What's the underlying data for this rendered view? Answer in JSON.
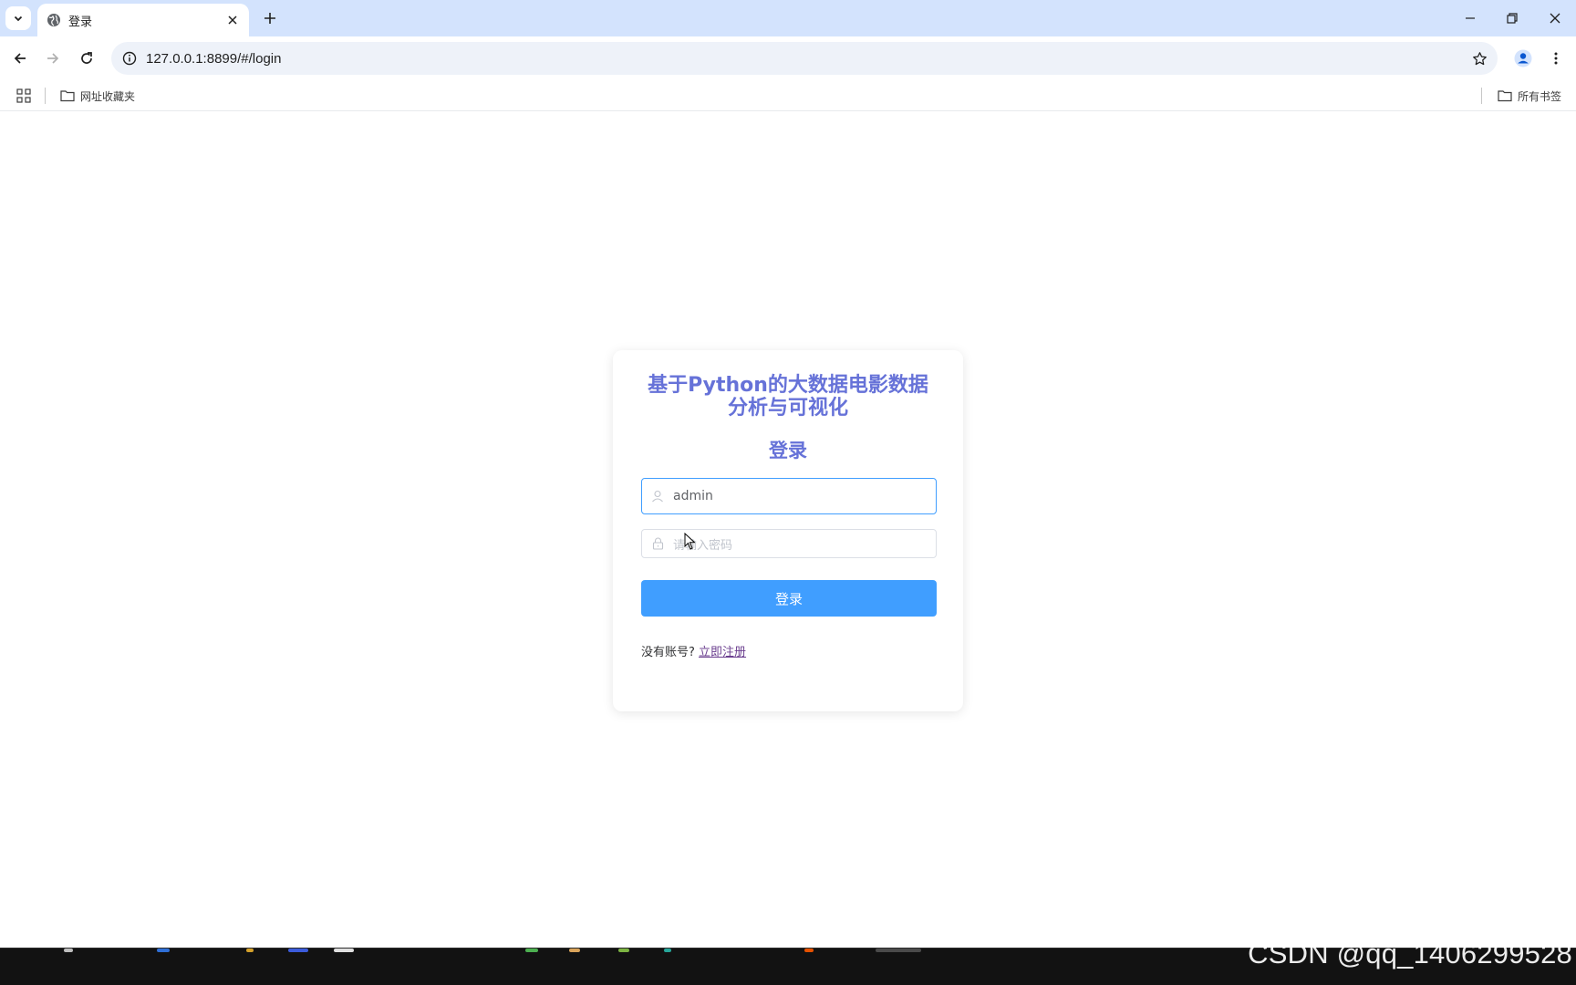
{
  "browser": {
    "tab_title": "登录",
    "url": "127.0.0.1:8899/#/login",
    "bookmarks": [
      {
        "label": "网址收藏夹"
      },
      {
        "label": "所有书签"
      }
    ]
  },
  "login": {
    "app_title": "基于Python的大数据电影数据分析与可视化",
    "heading": "登录",
    "username_value": "admin",
    "password_placeholder": "请输入密码",
    "login_button": "登录",
    "register_prompt": "没有账号?",
    "register_link": "立即注册"
  },
  "watermark": "CSDN @qq_1406299528",
  "colors": {
    "accent": "#409eff",
    "title": "#6672d8",
    "tabstrip": "#d3e3fd"
  }
}
